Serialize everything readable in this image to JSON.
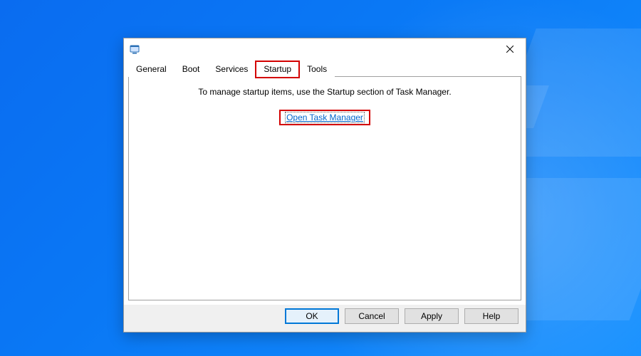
{
  "tabs": {
    "general": "General",
    "boot": "Boot",
    "services": "Services",
    "startup": "Startup",
    "tools": "Tools",
    "active": "startup"
  },
  "content": {
    "info": "To manage startup items, use the Startup section of Task Manager.",
    "link": "Open Task Manager"
  },
  "buttons": {
    "ok": "OK",
    "cancel": "Cancel",
    "apply": "Apply",
    "help": "Help"
  },
  "highlight": {
    "tab": "startup",
    "link": true
  }
}
